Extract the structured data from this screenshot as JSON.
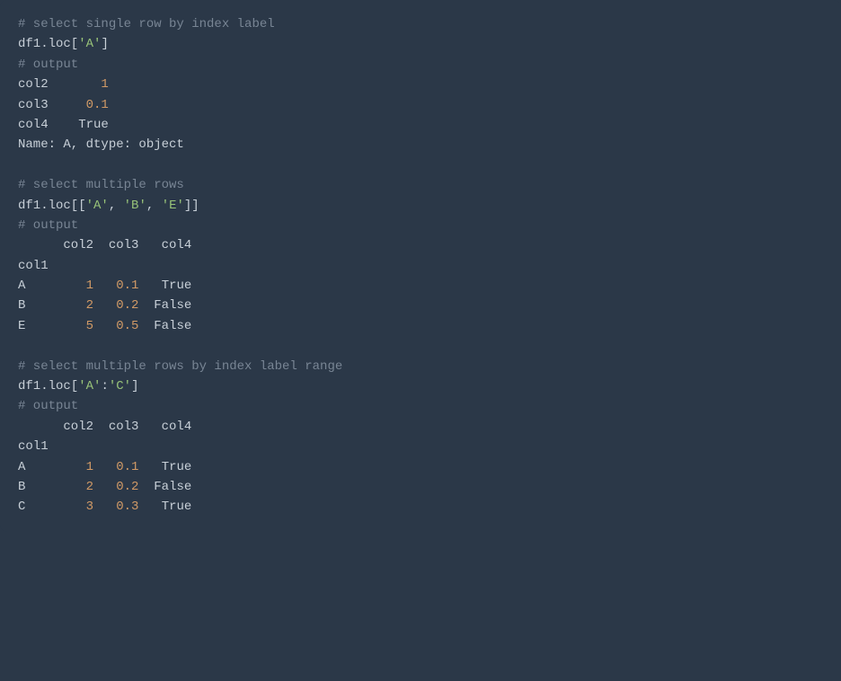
{
  "lines": [
    {
      "tokens": [
        {
          "type": "comment",
          "text": "# select single row by index label"
        }
      ]
    },
    {
      "tokens": [
        {
          "type": "default",
          "text": "df1.loc["
        },
        {
          "type": "string",
          "text": "'A'"
        },
        {
          "type": "default",
          "text": "]"
        }
      ]
    },
    {
      "tokens": [
        {
          "type": "comment",
          "text": "# output"
        }
      ]
    },
    {
      "tokens": [
        {
          "type": "default",
          "text": "col2       "
        },
        {
          "type": "number",
          "text": "1"
        }
      ]
    },
    {
      "tokens": [
        {
          "type": "default",
          "text": "col3     "
        },
        {
          "type": "number",
          "text": "0.1"
        }
      ]
    },
    {
      "tokens": [
        {
          "type": "default",
          "text": "col4    "
        },
        {
          "type": "bool",
          "text": "True"
        }
      ]
    },
    {
      "tokens": [
        {
          "type": "default",
          "text": "Name: A, dtype: "
        },
        {
          "type": "default",
          "text": "object"
        }
      ]
    },
    {
      "blank": true
    },
    {
      "tokens": [
        {
          "type": "comment",
          "text": "# select multiple rows"
        }
      ]
    },
    {
      "tokens": [
        {
          "type": "default",
          "text": "df1.loc[["
        },
        {
          "type": "string",
          "text": "'A'"
        },
        {
          "type": "default",
          "text": ", "
        },
        {
          "type": "string",
          "text": "'B'"
        },
        {
          "type": "default",
          "text": ", "
        },
        {
          "type": "string",
          "text": "'E'"
        },
        {
          "type": "default",
          "text": "]]"
        }
      ]
    },
    {
      "tokens": [
        {
          "type": "comment",
          "text": "# output"
        }
      ]
    },
    {
      "tokens": [
        {
          "type": "default",
          "text": "      col2  col3   col4"
        }
      ]
    },
    {
      "tokens": [
        {
          "type": "default",
          "text": "col1"
        }
      ]
    },
    {
      "tokens": [
        {
          "type": "default",
          "text": "A        "
        },
        {
          "type": "number",
          "text": "1"
        },
        {
          "type": "default",
          "text": "   "
        },
        {
          "type": "number",
          "text": "0.1"
        },
        {
          "type": "default",
          "text": "   "
        },
        {
          "type": "bool",
          "text": "True"
        }
      ]
    },
    {
      "tokens": [
        {
          "type": "default",
          "text": "B        "
        },
        {
          "type": "number",
          "text": "2"
        },
        {
          "type": "default",
          "text": "   "
        },
        {
          "type": "number",
          "text": "0.2"
        },
        {
          "type": "default",
          "text": "  "
        },
        {
          "type": "bool",
          "text": "False"
        }
      ]
    },
    {
      "tokens": [
        {
          "type": "default",
          "text": "E        "
        },
        {
          "type": "number",
          "text": "5"
        },
        {
          "type": "default",
          "text": "   "
        },
        {
          "type": "number",
          "text": "0.5"
        },
        {
          "type": "default",
          "text": "  "
        },
        {
          "type": "bool",
          "text": "False"
        }
      ]
    },
    {
      "blank": true
    },
    {
      "tokens": [
        {
          "type": "comment",
          "text": "# select multiple rows by index label range"
        }
      ]
    },
    {
      "tokens": [
        {
          "type": "default",
          "text": "df1.loc["
        },
        {
          "type": "string",
          "text": "'A'"
        },
        {
          "type": "default",
          "text": ":"
        },
        {
          "type": "string",
          "text": "'C'"
        },
        {
          "type": "default",
          "text": "]"
        }
      ]
    },
    {
      "tokens": [
        {
          "type": "comment",
          "text": "# output"
        }
      ]
    },
    {
      "tokens": [
        {
          "type": "default",
          "text": "      col2  col3   col4"
        }
      ]
    },
    {
      "tokens": [
        {
          "type": "default",
          "text": "col1"
        }
      ]
    },
    {
      "tokens": [
        {
          "type": "default",
          "text": "A        "
        },
        {
          "type": "number",
          "text": "1"
        },
        {
          "type": "default",
          "text": "   "
        },
        {
          "type": "number",
          "text": "0.1"
        },
        {
          "type": "default",
          "text": "   "
        },
        {
          "type": "bool",
          "text": "True"
        }
      ]
    },
    {
      "tokens": [
        {
          "type": "default",
          "text": "B        "
        },
        {
          "type": "number",
          "text": "2"
        },
        {
          "type": "default",
          "text": "   "
        },
        {
          "type": "number",
          "text": "0.2"
        },
        {
          "type": "default",
          "text": "  "
        },
        {
          "type": "bool",
          "text": "False"
        }
      ]
    },
    {
      "tokens": [
        {
          "type": "default",
          "text": "C        "
        },
        {
          "type": "number",
          "text": "3"
        },
        {
          "type": "default",
          "text": "   "
        },
        {
          "type": "number",
          "text": "0.3"
        },
        {
          "type": "default",
          "text": "   "
        },
        {
          "type": "bool",
          "text": "True"
        }
      ]
    }
  ]
}
